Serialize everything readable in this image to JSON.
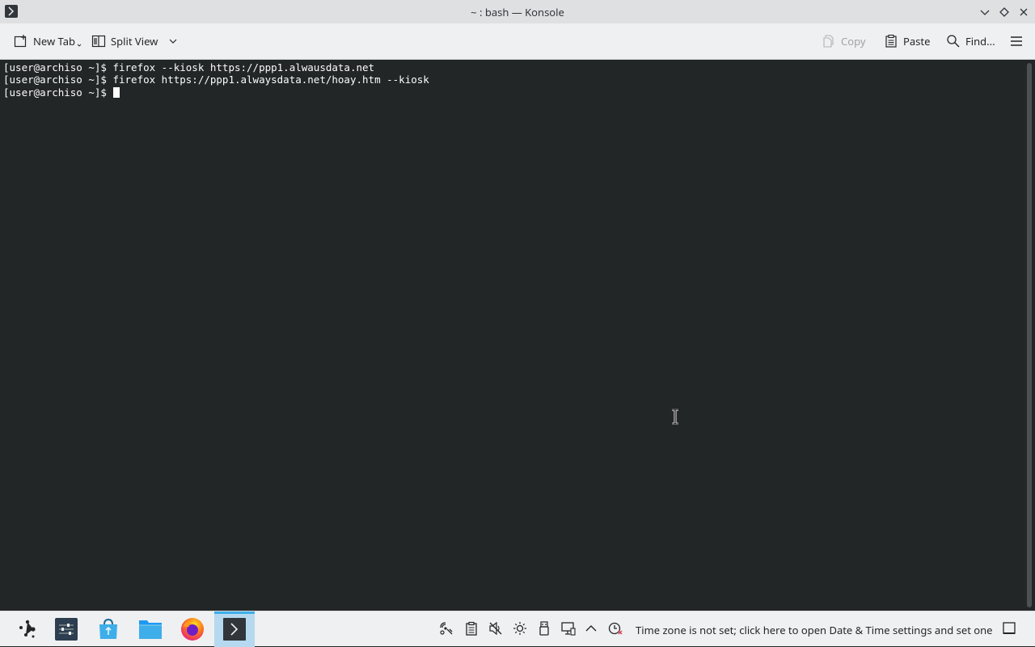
{
  "window": {
    "title": "~ : bash — Konsole"
  },
  "toolbar": {
    "new_tab": "New Tab",
    "split_view": "Split View",
    "copy": "Copy",
    "paste": "Paste",
    "find": "Find..."
  },
  "terminal": {
    "lines": [
      "[user@archiso ~]$ firefox --kiosk https://ppp1.alwausdata.net",
      "[user@archiso ~]$ firefox https://ppp1.alwaysdata.net/hoay.htm --kiosk"
    ],
    "prompt": "[user@archiso ~]$ "
  },
  "taskbar": {
    "apps": [
      "application-launcher-icon",
      "system-settings-icon",
      "discover-icon",
      "file-manager-icon",
      "firefox-icon",
      "konsole-icon"
    ],
    "status_message": "Time zone is not set; click here to open Date & Time settings and set one"
  },
  "colors": {
    "terminal_bg": "#232627",
    "terminal_fg": "#fcfcfc",
    "accent": "#3daee9",
    "panel_bg": "#eff0f1"
  }
}
